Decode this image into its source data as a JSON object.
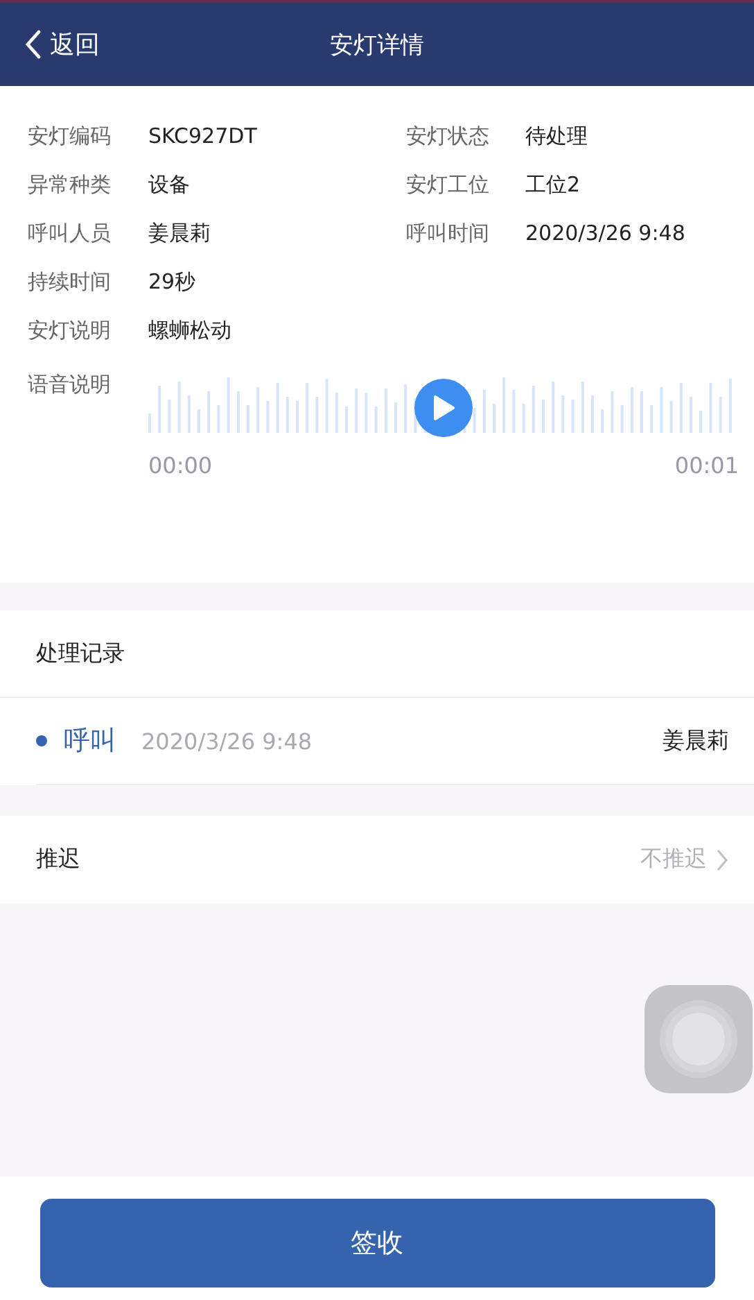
{
  "header": {
    "back": "返回",
    "title": "安灯详情"
  },
  "details": [
    {
      "cells": [
        {
          "label": "安灯编码",
          "value": "SKC927DT"
        },
        {
          "label": "安灯状态",
          "value": "待处理"
        }
      ]
    },
    {
      "cells": [
        {
          "label": "异常种类",
          "value": "设备"
        },
        {
          "label": "安灯工位",
          "value": "工位2"
        }
      ]
    },
    {
      "cells": [
        {
          "label": "呼叫人员",
          "value": "姜晨莉"
        },
        {
          "label": "呼叫时间",
          "value": "2020/3/26 9:48"
        }
      ]
    },
    {
      "cells": [
        {
          "label": "持续时间",
          "value": "29秒"
        }
      ]
    },
    {
      "cells": [
        {
          "label": "安灯说明",
          "value": "螺蛳松动"
        }
      ]
    }
  ],
  "voice": {
    "label": "语音说明",
    "start": "00:00",
    "end": "00:01"
  },
  "records": {
    "title": "处理记录",
    "items": [
      {
        "action": "呼叫",
        "time": "2020/3/26 9:48",
        "person": "姜晨莉"
      }
    ]
  },
  "delay": {
    "label": "推迟",
    "value": "不推迟"
  },
  "sign_button": "签收"
}
